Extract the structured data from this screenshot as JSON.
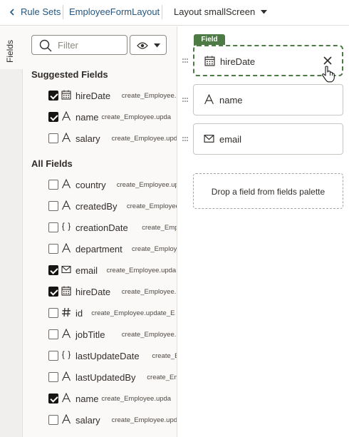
{
  "header": {
    "back_label": "Rule Sets",
    "form_name": "EmployeeFormLayout",
    "layout_label": "Layout smallScreen"
  },
  "rail": {
    "tab_label": "Fields"
  },
  "panel": {
    "filter_placeholder": "Filter",
    "suggested_title": "Suggested Fields",
    "all_title": "All Fields",
    "suggested": [
      {
        "name": "hireDate",
        "sub": "create_Employee.u",
        "checked": true,
        "icon": "calendar-icon"
      },
      {
        "name": "name",
        "sub": "create_Employee.upda",
        "checked": true,
        "icon": "text-type-icon"
      },
      {
        "name": "salary",
        "sub": "create_Employee.upda",
        "checked": false,
        "icon": "text-type-icon"
      }
    ],
    "all": [
      {
        "name": "country",
        "sub": "create_Employee.up",
        "checked": false,
        "icon": "text-type-icon"
      },
      {
        "name": "createdBy",
        "sub": "create_Employee",
        "checked": false,
        "icon": "text-type-icon"
      },
      {
        "name": "creationDate",
        "sub": "create_Emplo",
        "checked": false,
        "icon": "object-braces-icon"
      },
      {
        "name": "department",
        "sub": "create_Employ",
        "checked": false,
        "icon": "text-type-icon"
      },
      {
        "name": "email",
        "sub": "create_Employee.upda",
        "checked": true,
        "icon": "envelope-icon"
      },
      {
        "name": "hireDate",
        "sub": "create_Employee.u",
        "checked": true,
        "icon": "calendar-icon"
      },
      {
        "name": "id",
        "sub": "create_Employee.update_E",
        "checked": false,
        "icon": "hash-icon"
      },
      {
        "name": "jobTitle",
        "sub": "create_Employee.up",
        "checked": false,
        "icon": "text-type-icon"
      },
      {
        "name": "lastUpdateDate",
        "sub": "create_Em",
        "checked": false,
        "icon": "object-braces-icon"
      },
      {
        "name": "lastUpdatedBy",
        "sub": "create_Emp",
        "checked": false,
        "icon": "text-type-icon"
      },
      {
        "name": "name",
        "sub": "create_Employee.upda",
        "checked": true,
        "icon": "text-type-icon"
      },
      {
        "name": "salary",
        "sub": "create_Employee.upda",
        "checked": false,
        "icon": "text-type-icon"
      }
    ]
  },
  "canvas": {
    "selected_tag": "Field",
    "cards": [
      {
        "label": "hireDate",
        "icon": "calendar-icon",
        "selected": true
      },
      {
        "label": "name",
        "icon": "text-type-icon",
        "selected": false
      },
      {
        "label": "email",
        "icon": "envelope-icon",
        "selected": false
      }
    ],
    "drop_text": "Drop a field from fields palette"
  },
  "colors": {
    "accent_green": "#4e7a45",
    "link_blue": "#25567f"
  }
}
